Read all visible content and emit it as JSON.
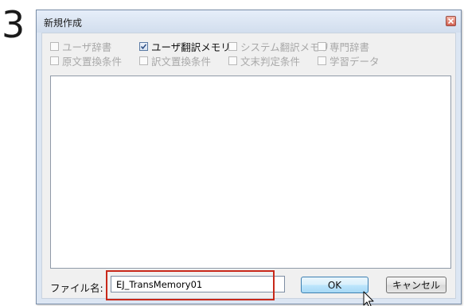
{
  "step": "3",
  "dialog": {
    "title": "新規作成",
    "close_icon": "close-icon"
  },
  "options": [
    {
      "label": "ユーザ辞書",
      "checked": false,
      "enabled": false
    },
    {
      "label": "ユーザ翻訳メモリ",
      "checked": true,
      "enabled": true
    },
    {
      "label": "システム翻訳メモリ",
      "checked": false,
      "enabled": false
    },
    {
      "label": "専門辞書",
      "checked": false,
      "enabled": false
    },
    {
      "label": "原文置換条件",
      "checked": false,
      "enabled": false
    },
    {
      "label": "訳文置換条件",
      "checked": false,
      "enabled": false
    },
    {
      "label": "文末判定条件",
      "checked": false,
      "enabled": false
    },
    {
      "label": "学習データ",
      "checked": false,
      "enabled": false
    }
  ],
  "filename": {
    "label": "ファイル名:",
    "value": "EJ_TransMemory01"
  },
  "buttons": {
    "ok": "OK",
    "cancel": "キャンセル"
  },
  "colors": {
    "highlight": "#c8281a",
    "dialog_frame": "#dce6f3",
    "close_button": "#d26050"
  }
}
